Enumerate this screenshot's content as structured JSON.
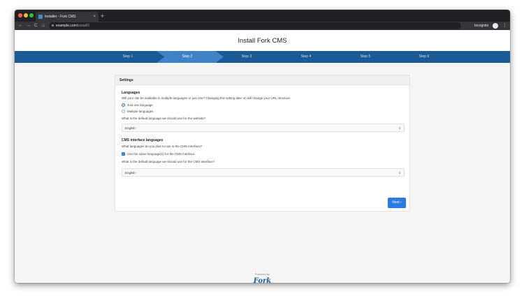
{
  "browser": {
    "tab_title": "Installer - Fork CMS",
    "tab_close": "×",
    "new_tab": "+",
    "url_host": "example.com",
    "url_path": "/install/2",
    "nav_back": "←",
    "nav_forward": "→",
    "nav_reload": "C",
    "nav_home": "⌂",
    "incognito_label": "Incognito",
    "menu": "⋮"
  },
  "page": {
    "title": "Install Fork CMS"
  },
  "steps": [
    {
      "label": "Step 1",
      "active": false
    },
    {
      "label": "Step 2",
      "active": true
    },
    {
      "label": "Step 3",
      "active": false
    },
    {
      "label": "Step 4",
      "active": false
    },
    {
      "label": "Step 5",
      "active": false
    },
    {
      "label": "Step 6",
      "active": false
    }
  ],
  "settings": {
    "heading": "Settings",
    "languages": {
      "heading": "Languages",
      "description": "Will your site be available in multiple languages or just one? Changing this setting later on will change your URL structure.",
      "option_single": "Just one language",
      "option_single_selected": true,
      "option_multiple": "Multiple languages",
      "option_multiple_selected": false,
      "default_question": "What is the default language we should use for the website?",
      "default_value": "English"
    },
    "cms": {
      "heading": "CMS interface languages",
      "question": "What languages do you plan to use in the CMS interface?",
      "same_checkbox": "Use the same language(s) for the CMS interface.",
      "same_checked": true,
      "default_question": "What is the default language we should use for the CMS interface?",
      "default_value": "English"
    },
    "next_label": "Next"
  },
  "footer": {
    "powered_by": "Powered by",
    "logo": "Fork"
  },
  "colors": {
    "steps_bar": "#1c5a96",
    "step_active": "#3f83c6",
    "accent": "#2a7be4"
  }
}
